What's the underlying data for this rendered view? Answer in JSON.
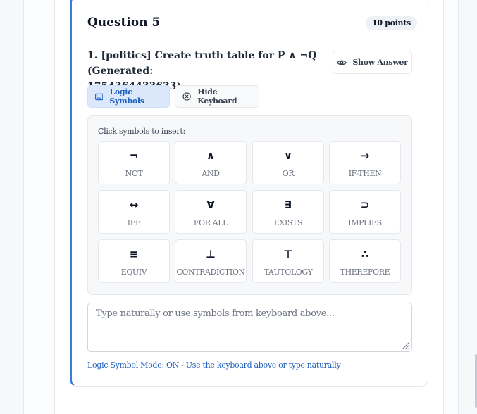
{
  "question": {
    "title": "Question 5",
    "points": "10 points",
    "prompt_line1": "1. [politics] Create truth table for P ∧ ¬Q (Generated:",
    "prompt_line2": "1754364433633)"
  },
  "buttons": {
    "show_answer": "Show Answer",
    "logic_symbols": "Logic Symbols",
    "hide_keyboard": "Hide Keyboard"
  },
  "keyboard": {
    "title": "Click symbols to insert:",
    "symbols": [
      {
        "glyph": "¬",
        "label": "NOT"
      },
      {
        "glyph": "∧",
        "label": "AND"
      },
      {
        "glyph": "∨",
        "label": "OR"
      },
      {
        "glyph": "→",
        "label": "IF-THEN"
      },
      {
        "glyph": "↔",
        "label": "IFF"
      },
      {
        "glyph": "∀",
        "label": "FOR ALL"
      },
      {
        "glyph": "∃",
        "label": "EXISTS"
      },
      {
        "glyph": "⊃",
        "label": "IMPLIES"
      },
      {
        "glyph": "≡",
        "label": "EQUIV"
      },
      {
        "glyph": "⊥",
        "label": "CONTRADICTION"
      },
      {
        "glyph": "⊤",
        "label": "TAUTOLOGY"
      },
      {
        "glyph": "∴",
        "label": "THEREFORE"
      }
    ]
  },
  "answer": {
    "value": "",
    "placeholder": "Type naturally or use symbols from keyboard above..."
  },
  "status": "Logic Symbol Mode: ON - Use the keyboard above or type naturally",
  "colors": {
    "accent": "#3b7bd9",
    "accent_text": "#1d5fbf",
    "active_bg": "#dbe8fb"
  }
}
